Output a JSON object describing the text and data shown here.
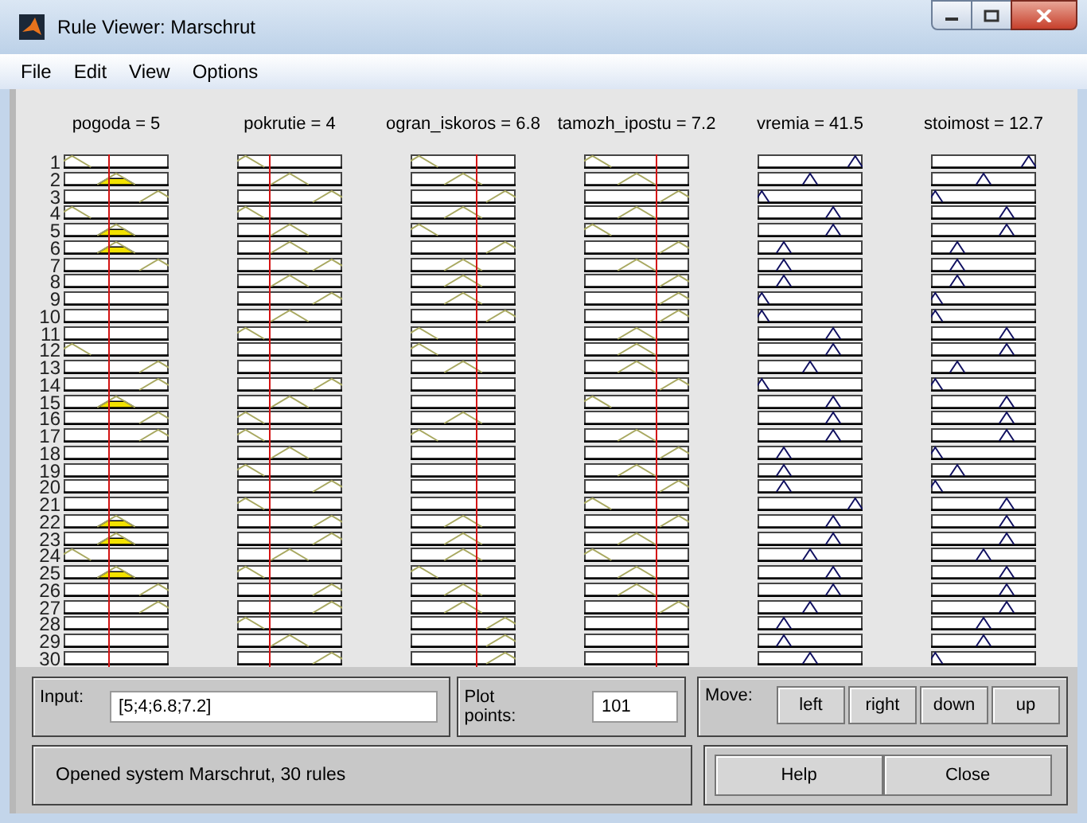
{
  "window": {
    "title": "Rule Viewer: Marschrut"
  },
  "menu": [
    "File",
    "Edit",
    "View",
    "Options"
  ],
  "rule_numbers": [
    "1",
    "2",
    "3",
    "4",
    "5",
    "6",
    "7",
    "8",
    "9",
    "10",
    "11",
    "12",
    "13",
    "14",
    "15",
    "16",
    "17",
    "18",
    "19",
    "20",
    "21",
    "22",
    "23",
    "24",
    "25",
    "26",
    "27",
    "28",
    "29",
    "30"
  ],
  "variables": [
    {
      "label": "pogoda = 5",
      "kind": "input",
      "cells": [
        {
          "kind": "low",
          "fired": false
        },
        {
          "kind": "mid",
          "fired": true
        },
        {
          "kind": "high",
          "fired": false
        },
        {
          "kind": "low",
          "fired": false
        },
        {
          "kind": "mid",
          "fired": true
        },
        {
          "kind": "mid",
          "fired": true
        },
        {
          "kind": "high",
          "fired": false
        },
        {
          "kind": "none"
        },
        {
          "kind": "none"
        },
        {
          "kind": "none"
        },
        {
          "kind": "none"
        },
        {
          "kind": "low",
          "fired": false
        },
        {
          "kind": "high",
          "fired": false
        },
        {
          "kind": "high",
          "fired": false
        },
        {
          "kind": "mid",
          "fired": true
        },
        {
          "kind": "high",
          "fired": false
        },
        {
          "kind": "high",
          "fired": false
        },
        {
          "kind": "none"
        },
        {
          "kind": "none"
        },
        {
          "kind": "none"
        },
        {
          "kind": "none"
        },
        {
          "kind": "mid",
          "fired": true
        },
        {
          "kind": "mid",
          "fired": true
        },
        {
          "kind": "low",
          "fired": false
        },
        {
          "kind": "mid",
          "fired": true
        },
        {
          "kind": "high",
          "fired": false
        },
        {
          "kind": "high",
          "fired": false
        },
        {
          "kind": "none"
        },
        {
          "kind": "none"
        },
        {
          "kind": "none"
        }
      ]
    },
    {
      "label": "pokrutie = 4",
      "kind": "input",
      "cells": [
        {
          "kind": "low",
          "fired": false
        },
        {
          "kind": "mid",
          "fired": false
        },
        {
          "kind": "high",
          "fired": false
        },
        {
          "kind": "low",
          "fired": false
        },
        {
          "kind": "mid",
          "fired": false
        },
        {
          "kind": "mid",
          "fired": false
        },
        {
          "kind": "high",
          "fired": false
        },
        {
          "kind": "mid",
          "fired": false
        },
        {
          "kind": "high",
          "fired": false
        },
        {
          "kind": "mid",
          "fired": false
        },
        {
          "kind": "low",
          "fired": false
        },
        {
          "kind": "none"
        },
        {
          "kind": "none"
        },
        {
          "kind": "high",
          "fired": false
        },
        {
          "kind": "mid",
          "fired": false
        },
        {
          "kind": "low",
          "fired": false
        },
        {
          "kind": "low",
          "fired": false
        },
        {
          "kind": "mid",
          "fired": false
        },
        {
          "kind": "low",
          "fired": false
        },
        {
          "kind": "high",
          "fired": false
        },
        {
          "kind": "low",
          "fired": false
        },
        {
          "kind": "high",
          "fired": false
        },
        {
          "kind": "high",
          "fired": false
        },
        {
          "kind": "mid",
          "fired": false
        },
        {
          "kind": "low",
          "fired": false
        },
        {
          "kind": "high",
          "fired": false
        },
        {
          "kind": "high",
          "fired": false
        },
        {
          "kind": "low",
          "fired": false
        },
        {
          "kind": "mid",
          "fired": false
        },
        {
          "kind": "high",
          "fired": false
        }
      ]
    },
    {
      "label": "ogran_iskoros = 6.8",
      "kind": "input",
      "cells": [
        {
          "kind": "low",
          "fired": false
        },
        {
          "kind": "mid",
          "fired": false
        },
        {
          "kind": "high",
          "fired": false
        },
        {
          "kind": "mid",
          "fired": false
        },
        {
          "kind": "low",
          "fired": false
        },
        {
          "kind": "high",
          "fired": false
        },
        {
          "kind": "mid",
          "fired": false
        },
        {
          "kind": "mid",
          "fired": false
        },
        {
          "kind": "mid",
          "fired": false
        },
        {
          "kind": "high",
          "fired": false
        },
        {
          "kind": "low",
          "fired": false
        },
        {
          "kind": "low",
          "fired": false
        },
        {
          "kind": "mid",
          "fired": false
        },
        {
          "kind": "none"
        },
        {
          "kind": "none"
        },
        {
          "kind": "mid",
          "fired": false
        },
        {
          "kind": "low",
          "fired": false
        },
        {
          "kind": "none"
        },
        {
          "kind": "none"
        },
        {
          "kind": "none"
        },
        {
          "kind": "none"
        },
        {
          "kind": "mid",
          "fired": false
        },
        {
          "kind": "mid",
          "fired": false
        },
        {
          "kind": "mid",
          "fired": false
        },
        {
          "kind": "low",
          "fired": false
        },
        {
          "kind": "mid",
          "fired": false
        },
        {
          "kind": "mid",
          "fired": false
        },
        {
          "kind": "high",
          "fired": false
        },
        {
          "kind": "high",
          "fired": false
        },
        {
          "kind": "high",
          "fired": false
        }
      ]
    },
    {
      "label": "tamozh_ipostu = 7.2",
      "kind": "input",
      "cells": [
        {
          "kind": "low",
          "fired": false
        },
        {
          "kind": "mid",
          "fired": false
        },
        {
          "kind": "high",
          "fired": false
        },
        {
          "kind": "mid",
          "fired": false
        },
        {
          "kind": "low",
          "fired": false
        },
        {
          "kind": "high",
          "fired": false
        },
        {
          "kind": "mid",
          "fired": false
        },
        {
          "kind": "high",
          "fired": false
        },
        {
          "kind": "high",
          "fired": false
        },
        {
          "kind": "high",
          "fired": false
        },
        {
          "kind": "mid",
          "fired": false
        },
        {
          "kind": "mid",
          "fired": false
        },
        {
          "kind": "mid",
          "fired": false
        },
        {
          "kind": "high",
          "fired": false
        },
        {
          "kind": "low",
          "fired": false
        },
        {
          "kind": "none"
        },
        {
          "kind": "mid",
          "fired": false
        },
        {
          "kind": "high",
          "fired": false
        },
        {
          "kind": "mid",
          "fired": false
        },
        {
          "kind": "high",
          "fired": false
        },
        {
          "kind": "low",
          "fired": false
        },
        {
          "kind": "high",
          "fired": false
        },
        {
          "kind": "mid",
          "fired": false
        },
        {
          "kind": "low",
          "fired": false
        },
        {
          "kind": "mid",
          "fired": false
        },
        {
          "kind": "mid",
          "fired": false
        },
        {
          "kind": "high",
          "fired": false
        },
        {
          "kind": "none"
        },
        {
          "kind": "none"
        },
        {
          "kind": "none"
        }
      ]
    },
    {
      "label": "vremia = 41.5",
      "kind": "output",
      "cells": [
        {
          "kind": "very_high"
        },
        {
          "kind": "mid"
        },
        {
          "kind": "very_low"
        },
        {
          "kind": "high"
        },
        {
          "kind": "high"
        },
        {
          "kind": "low"
        },
        {
          "kind": "low"
        },
        {
          "kind": "low"
        },
        {
          "kind": "very_low"
        },
        {
          "kind": "very_low"
        },
        {
          "kind": "high"
        },
        {
          "kind": "high"
        },
        {
          "kind": "mid"
        },
        {
          "kind": "very_low"
        },
        {
          "kind": "high"
        },
        {
          "kind": "high"
        },
        {
          "kind": "high"
        },
        {
          "kind": "low"
        },
        {
          "kind": "low"
        },
        {
          "kind": "low"
        },
        {
          "kind": "very_high"
        },
        {
          "kind": "high"
        },
        {
          "kind": "high"
        },
        {
          "kind": "mid"
        },
        {
          "kind": "high"
        },
        {
          "kind": "high"
        },
        {
          "kind": "mid"
        },
        {
          "kind": "low"
        },
        {
          "kind": "low"
        },
        {
          "kind": "mid"
        }
      ]
    },
    {
      "label": "stoimost = 12.7",
      "kind": "output",
      "cells": [
        {
          "kind": "very_high"
        },
        {
          "kind": "mid"
        },
        {
          "kind": "very_low"
        },
        {
          "kind": "high"
        },
        {
          "kind": "high"
        },
        {
          "kind": "low"
        },
        {
          "kind": "low"
        },
        {
          "kind": "low"
        },
        {
          "kind": "very_low"
        },
        {
          "kind": "very_low"
        },
        {
          "kind": "high"
        },
        {
          "kind": "high"
        },
        {
          "kind": "low"
        },
        {
          "kind": "very_low"
        },
        {
          "kind": "high"
        },
        {
          "kind": "high"
        },
        {
          "kind": "high"
        },
        {
          "kind": "very_low"
        },
        {
          "kind": "low"
        },
        {
          "kind": "very_low"
        },
        {
          "kind": "high"
        },
        {
          "kind": "high"
        },
        {
          "kind": "high"
        },
        {
          "kind": "mid"
        },
        {
          "kind": "high"
        },
        {
          "kind": "high"
        },
        {
          "kind": "high"
        },
        {
          "kind": "mid"
        },
        {
          "kind": "mid"
        },
        {
          "kind": "very_low"
        }
      ]
    }
  ],
  "input": {
    "label": "Input:",
    "value": "[5;4;6.8;7.2]"
  },
  "plot_points": {
    "label": "Plot points:",
    "value": "101"
  },
  "move": {
    "label": "Move:",
    "buttons": [
      "left",
      "right",
      "down",
      "up"
    ]
  },
  "status": "Opened system Marschrut, 30 rules",
  "buttons": [
    "Help",
    "Close"
  ]
}
